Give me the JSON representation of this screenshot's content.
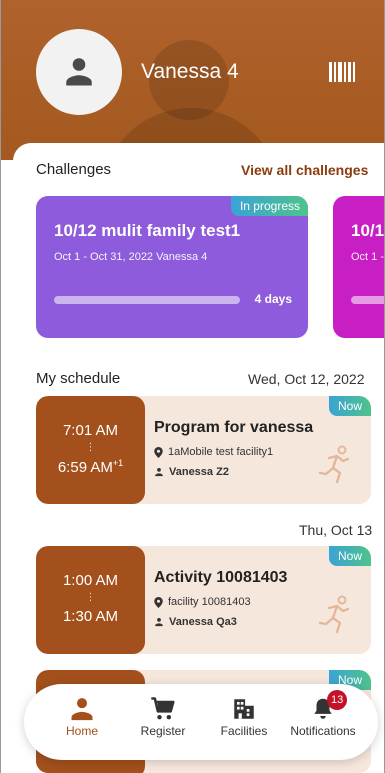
{
  "user": {
    "name": "Vanessa 4"
  },
  "challenges": {
    "heading": "Challenges",
    "view_all": "View all challenges",
    "cards": [
      {
        "status": "In progress",
        "title": "10/12 mulit family test1",
        "subtitle": "Oct 1 - Oct 31, 2022   Vanessa 4",
        "days": "4 days",
        "color": "#8e5bdc"
      },
      {
        "title": "10/1",
        "subtitle": "Oct 1 -",
        "color": "#c81fc4"
      }
    ]
  },
  "schedule": {
    "heading": "My schedule",
    "days": [
      {
        "date": "Wed, Oct 12, 2022",
        "items": [
          {
            "badge": "Now",
            "start": "7:01 AM",
            "end": "6:59 AM",
            "end_suffix": "+1",
            "title": "Program for vanessa",
            "place": "1aMobile test facility1",
            "person": "Vanessa Z2"
          }
        ]
      },
      {
        "date": "Thu, Oct 13",
        "items": [
          {
            "badge": "Now",
            "start": "1:00 AM",
            "end": "1:30 AM",
            "title": "Activity 10081403",
            "place": "facility 10081403",
            "person": "Vanessa Qa3"
          },
          {
            "badge": "Now"
          }
        ]
      }
    ]
  },
  "nav": {
    "items": [
      {
        "label": "Home",
        "icon": "person-icon",
        "active": true
      },
      {
        "label": "Register",
        "icon": "cart-icon"
      },
      {
        "label": "Facilities",
        "icon": "building-icon"
      },
      {
        "label": "Notifications",
        "icon": "bell-icon",
        "badge": "13"
      }
    ]
  },
  "colors": {
    "brand": "#a3501c",
    "challenge_purple": "#8e5bdc",
    "challenge_magenta": "#c81fc4",
    "badge_red": "#c3112a"
  }
}
